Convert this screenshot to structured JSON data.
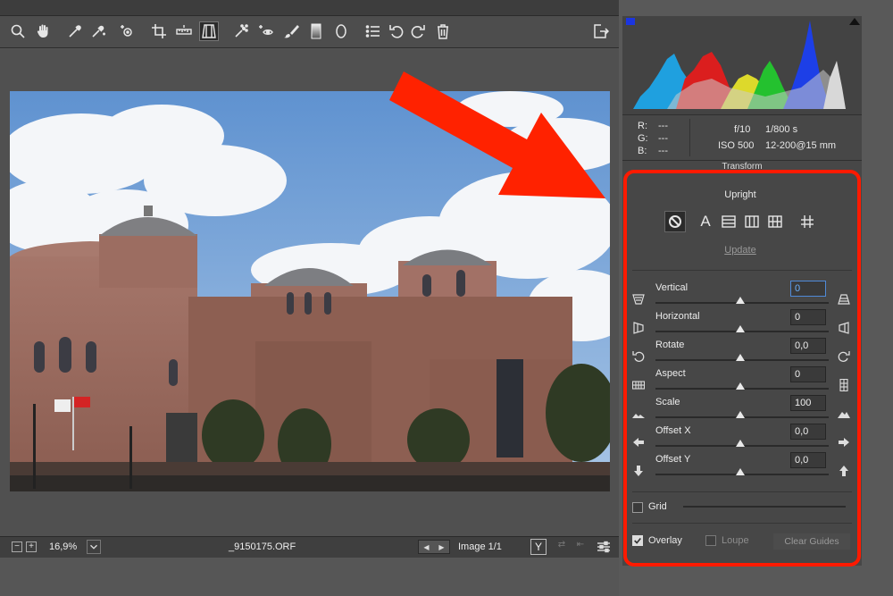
{
  "toolbar": {
    "tools": [
      "zoom-icon",
      "hand-icon",
      "white-balance-icon",
      "color-sampler-icon",
      "targeted-adjustment-icon",
      "crop-icon",
      "straighten-icon",
      "transform-icon",
      "spot-removal-icon",
      "red-eye-icon",
      "adjustment-brush-icon",
      "graduated-filter-icon",
      "radial-filter-icon",
      "preferences-icon",
      "rotate-left-icon",
      "rotate-right-icon",
      "trash-icon"
    ],
    "active_tool": "transform-icon"
  },
  "info": {
    "r_label": "R:",
    "r_value": "---",
    "g_label": "G:",
    "g_value": "---",
    "b_label": "B:",
    "b_value": "---",
    "aperture": "f/10",
    "shutter": "1/800 s",
    "iso": "ISO 500",
    "lens": "12-200@15 mm"
  },
  "panel": {
    "title": "Transform",
    "upright_label": "Upright",
    "upright_options": [
      "off-icon",
      "auto-icon",
      "level-icon",
      "vertical-icon",
      "full-icon",
      "guided-icon"
    ],
    "update_label": "Update",
    "sliders": [
      {
        "label": "Vertical",
        "value": "0"
      },
      {
        "label": "Horizontal",
        "value": "0"
      },
      {
        "label": "Rotate",
        "value": "0,0"
      },
      {
        "label": "Aspect",
        "value": "0"
      },
      {
        "label": "Scale",
        "value": "100"
      },
      {
        "label": "Offset X",
        "value": "0,0"
      },
      {
        "label": "Offset Y",
        "value": "0,0"
      }
    ],
    "grid_label": "Grid",
    "overlay_label": "Overlay",
    "loupe_label": "Loupe",
    "clear_guides_label": "Clear Guides"
  },
  "status": {
    "zoom": "16,9%",
    "filename": "_9150175.ORF",
    "image_counter": "Image 1/1"
  },
  "colors": {
    "highlight": "#ff1a00",
    "arrow": "#ff2200",
    "focus": "#4f8ad8"
  }
}
